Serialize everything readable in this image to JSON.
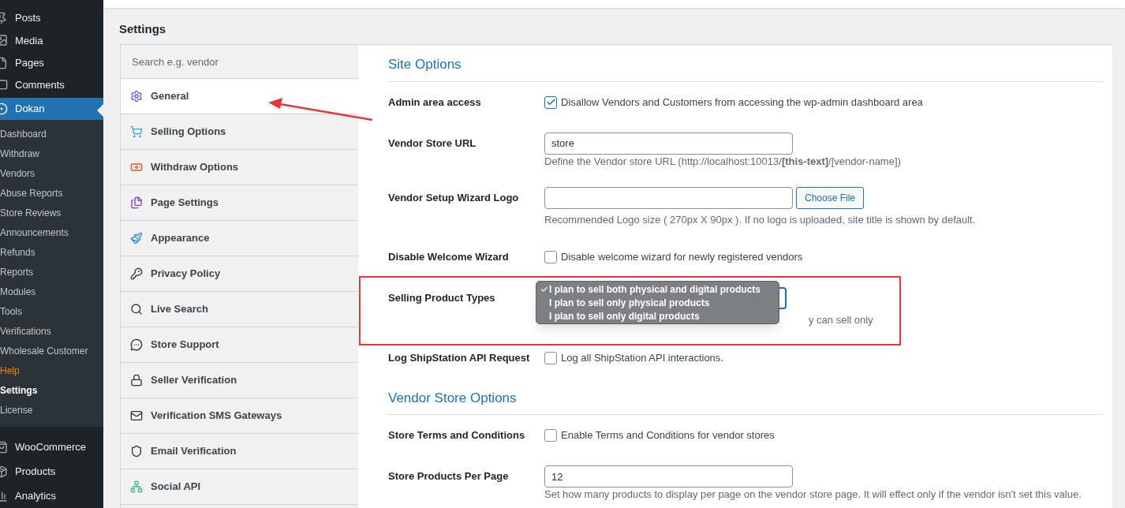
{
  "admin_menu": {
    "top_items": [
      {
        "label": "Posts",
        "selected": false
      },
      {
        "label": "Media",
        "selected": false
      },
      {
        "label": "Pages",
        "selected": false
      },
      {
        "label": "Comments",
        "selected": false
      }
    ],
    "active_item": {
      "label": "Dokan",
      "selected": true
    },
    "submenu": [
      {
        "label": "Dashboard",
        "selected": false,
        "highlighted": false
      },
      {
        "label": "Withdraw",
        "selected": false,
        "highlighted": false
      },
      {
        "label": "Vendors",
        "selected": false,
        "highlighted": false
      },
      {
        "label": "Abuse Reports",
        "selected": false,
        "highlighted": false
      },
      {
        "label": "Store Reviews",
        "selected": false,
        "highlighted": false
      },
      {
        "label": "Announcements",
        "selected": false,
        "highlighted": false
      },
      {
        "label": "Refunds",
        "selected": false,
        "highlighted": false
      },
      {
        "label": "Reports",
        "selected": false,
        "highlighted": false
      },
      {
        "label": "Modules",
        "selected": false,
        "highlighted": false
      },
      {
        "label": "Tools",
        "selected": false,
        "highlighted": false
      },
      {
        "label": "Verifications",
        "selected": false,
        "highlighted": false
      },
      {
        "label": "Wholesale Customer",
        "selected": false,
        "highlighted": false
      },
      {
        "label": "Help",
        "selected": false,
        "highlighted": true
      },
      {
        "label": "Settings",
        "selected": true,
        "highlighted": false
      },
      {
        "label": "License",
        "selected": false,
        "highlighted": false
      }
    ],
    "bottom_items": [
      {
        "label": "WooCommerce",
        "selected": false
      },
      {
        "label": "Products",
        "selected": false
      },
      {
        "label": "Analytics",
        "selected": false
      }
    ]
  },
  "page_title": "Settings",
  "settings_nav": {
    "search": {
      "placeholder": "Search e.g. vendor"
    },
    "items": [
      {
        "label": "General",
        "selected": true
      },
      {
        "label": "Selling Options",
        "selected": false
      },
      {
        "label": "Withdraw Options",
        "selected": false
      },
      {
        "label": "Page Settings",
        "selected": false
      },
      {
        "label": "Appearance",
        "selected": false
      },
      {
        "label": "Privacy Policy",
        "selected": false
      },
      {
        "label": "Live Search",
        "selected": false
      },
      {
        "label": "Store Support",
        "selected": false
      },
      {
        "label": "Seller Verification",
        "selected": false
      },
      {
        "label": "Verification SMS Gateways",
        "selected": false
      },
      {
        "label": "Email Verification",
        "selected": false
      },
      {
        "label": "Social API",
        "selected": false
      }
    ]
  },
  "sections": [
    {
      "title": "Site Options",
      "rows": [
        {
          "kind": "checkbox",
          "label": "Admin area access",
          "checked": true,
          "text": "Disallow Vendors and Customers from accessing the wp-admin dashboard area"
        },
        {
          "kind": "text",
          "label": "Vendor Store URL",
          "value": "store",
          "description": "Define the Vendor store URL (http://localhost:10013/**[this-text]**/[vendor-name])"
        },
        {
          "kind": "file",
          "label": "Vendor Setup Wizard Logo",
          "value": "",
          "button": "Choose File",
          "description": "Recommended Logo size ( 270px X 90px ). If no logo is uploaded, site title is shown by default."
        },
        {
          "kind": "checkbox",
          "label": "Disable Welcome Wizard",
          "checked": false,
          "text": "Disable welcome wizard for newly registered vendors"
        },
        {
          "kind": "select",
          "label": "Selling Product Types",
          "options": [
            {
              "label": "I plan to sell both physical and digital products",
              "selected": true
            },
            {
              "label": "I plan to sell only physical products",
              "selected": false
            },
            {
              "label": "I plan to sell only digital products",
              "selected": false
            }
          ],
          "description": "y can sell only"
        },
        {
          "kind": "checkbox",
          "label": "Log ShipStation API Request",
          "checked": false,
          "text": "Log all ShipStation API interactions."
        }
      ]
    },
    {
      "title": "Vendor Store Options",
      "rows": [
        {
          "kind": "checkbox",
          "label": "Store Terms and Conditions",
          "checked": false,
          "text": "Enable Terms and Conditions for vendor stores"
        },
        {
          "kind": "text",
          "label": "Store Products Per Page",
          "value": "12",
          "description": "Set how many products to display per page on the vendor store page. It will effect only if the vendor isn't set this value."
        }
      ]
    }
  ]
}
